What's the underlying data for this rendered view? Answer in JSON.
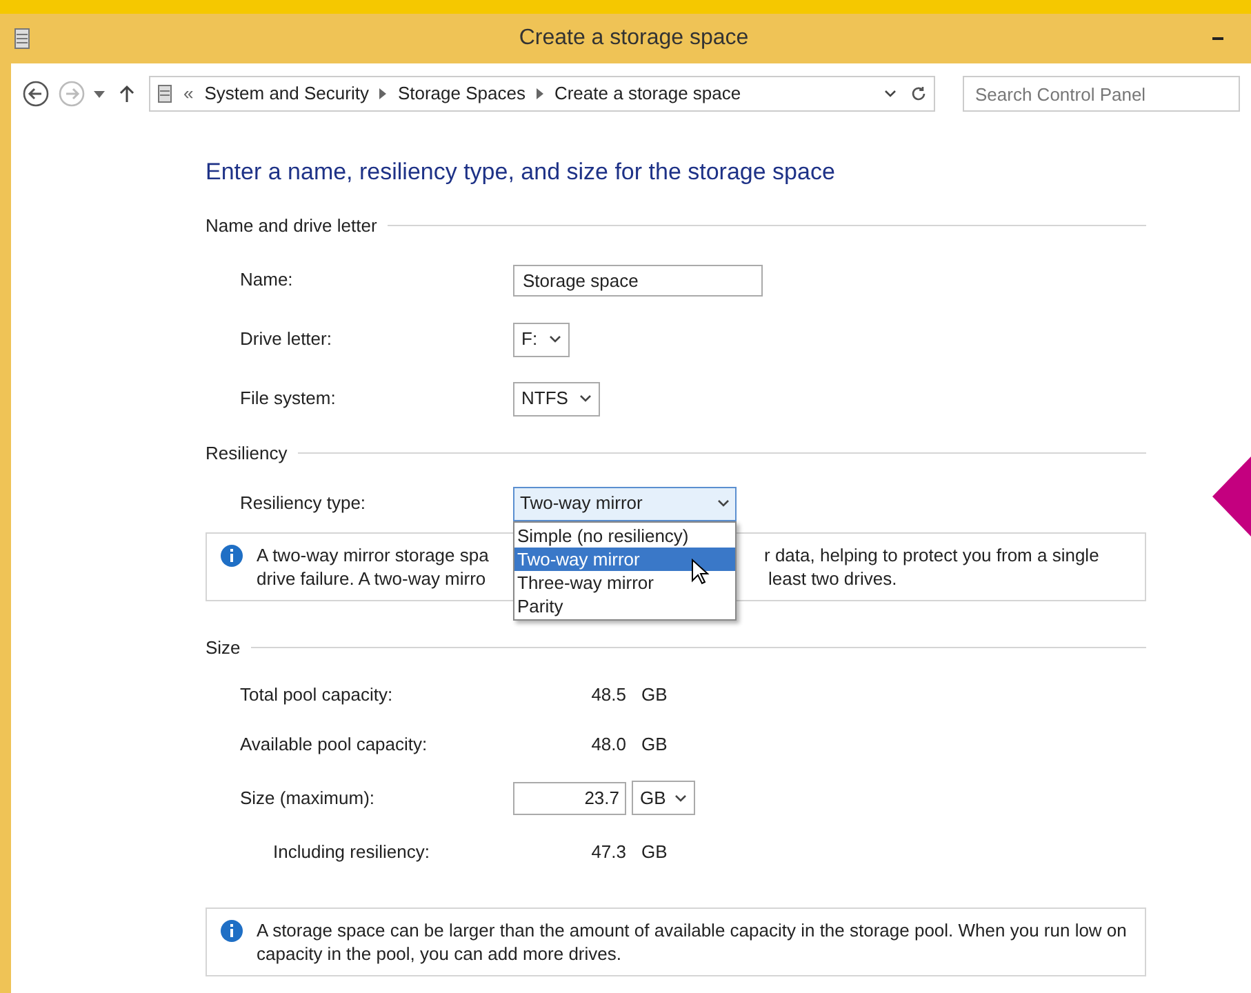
{
  "window": {
    "title": "Create a storage space"
  },
  "nav": {
    "overflow": "«",
    "breadcrumb": [
      "System and Security",
      "Storage Spaces",
      "Create a storage space"
    ],
    "search": {
      "placeholder": "Search Control Panel"
    }
  },
  "heading": "Enter a name, resiliency type, and size for the storage space",
  "name_section": {
    "title": "Name and drive letter",
    "fields": [
      {
        "label": "Name:",
        "kind": "text",
        "value": "Storage space"
      },
      {
        "label": "Drive letter:",
        "kind": "select",
        "value": "F:"
      },
      {
        "label": "File system:",
        "kind": "select",
        "value": "NTFS"
      }
    ]
  },
  "resiliency": {
    "title": "Resiliency",
    "label": "Resiliency type:",
    "value": "Two-way mirror",
    "expanded": true,
    "options": [
      {
        "label": "Simple (no resiliency)",
        "selected": false
      },
      {
        "label": "Two-way mirror",
        "selected": true
      },
      {
        "label": "Three-way mirror",
        "selected": false
      },
      {
        "label": "Parity",
        "selected": false
      }
    ],
    "info_left": [
      "A two-way mirror storage spa",
      "drive failure. A two-way mirro"
    ],
    "info_right": [
      "r data, helping to protect you from a single",
      "least two drives."
    ]
  },
  "size": {
    "title": "Size",
    "rows": [
      {
        "label": "Total pool capacity:",
        "kind": "value",
        "value": "48.5",
        "unit": "GB"
      },
      {
        "label": "Available pool capacity:",
        "kind": "value",
        "value": "48.0",
        "unit": "GB"
      },
      {
        "label": "Size (maximum):",
        "kind": "input",
        "value": "23.7",
        "unit": "GB"
      },
      {
        "label": "Including resiliency:",
        "kind": "indented",
        "value": "47.3",
        "unit": "GB"
      }
    ],
    "info": "A storage space can be larger than the amount of available capacity in the storage pool. When you run low on capacity in the pool, you can add more drives."
  }
}
